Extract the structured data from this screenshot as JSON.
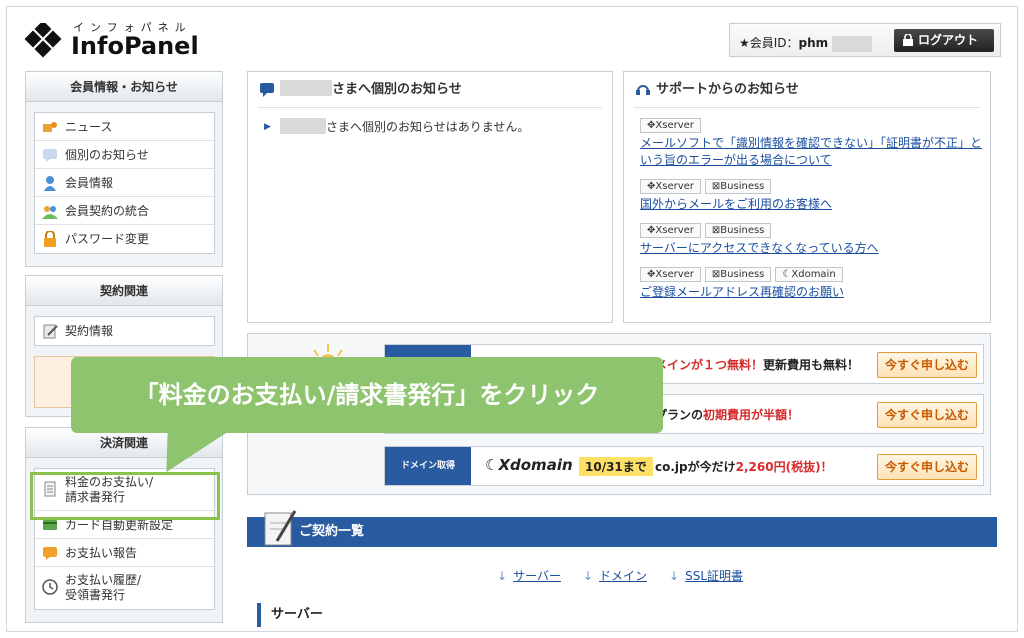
{
  "header": {
    "logo_kana": "インフォパネル",
    "logo_name": "InfoPanel",
    "member_label": "★会員ID：",
    "member_id": "phm",
    "logout_label": "ログアウト"
  },
  "sidebar": {
    "sections": [
      {
        "title": "会員情報・お知らせ",
        "items": [
          "ニュース",
          "個別のお知らせ",
          "会員情報",
          "会員契約の統合",
          "パスワード変更"
        ]
      },
      {
        "title": "契約関連",
        "items": [
          "契約情報"
        ]
      },
      {
        "title": "決済関連",
        "items": [
          "料金のお支払い/",
          "請求書発行",
          "カード自動更新設定",
          "お支払い報告",
          "お支払い履歴/",
          "受領書発行"
        ]
      }
    ]
  },
  "personal_notice": {
    "title_suffix": "さまへ個別のお知らせ",
    "body_suffix": "さまへ個別のお知らせはありません。"
  },
  "support_notice": {
    "title": "サポートからのお知らせ",
    "items": [
      {
        "tags": [
          "Xserver"
        ],
        "link": "メールソフトで「識別情報を確認できない」「証明書が不正」という旨のエラーが出る場合について"
      },
      {
        "tags": [
          "Xserver",
          "Business"
        ],
        "link": "国外からメールをご利用のお客様へ"
      },
      {
        "tags": [
          "Xserver",
          "Business"
        ],
        "link": "サーバーにアクセスできなくなっている方へ"
      },
      {
        "tags": [
          "Xserver",
          "Business",
          "Xdomain"
        ],
        "link": "ご登録メールアドレス再確認のお願い"
      }
    ]
  },
  "promo": {
    "rows": [
      {
        "text_red": "メインが１つ無料！",
        "text": "更新費用も無料！",
        "button": "今すぐ申し込む"
      },
      {
        "text": "プランの",
        "text_red": "初期費用が半額！",
        "button": "今すぐ申し込む"
      },
      {
        "label": "ドメイン取得",
        "logo": "Xdomain",
        "date": "10/31まで",
        "text": "co.jpが今だけ",
        "text_red": "2,260円(税抜)！",
        "button": "今すぐ申し込む"
      }
    ]
  },
  "callout": {
    "text": "「料金のお支払い/請求書発行」をクリック"
  },
  "contracts": {
    "title": "ご契約一覧",
    "anchors": [
      "サーバー",
      "ドメイン",
      "SSL証明書"
    ],
    "section": "サーバー"
  },
  "colors": {
    "brand_blue": "#2a5aa0",
    "highlight_green": "#8bc34a",
    "callout_green": "#8fc46f",
    "promo_red": "#d62b2b",
    "link_blue": "#1a4fa0"
  }
}
